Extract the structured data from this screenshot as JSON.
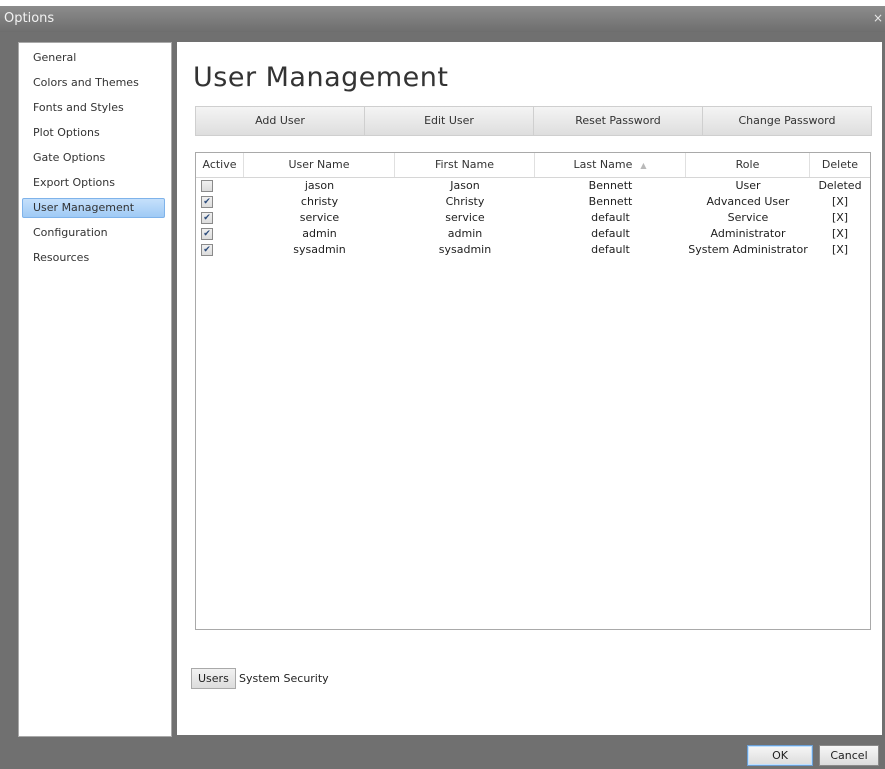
{
  "window": {
    "title": "Options",
    "close_glyph": "×"
  },
  "sidebar": {
    "items": [
      {
        "label": "General"
      },
      {
        "label": "Colors and Themes"
      },
      {
        "label": "Fonts and Styles"
      },
      {
        "label": "Plot Options"
      },
      {
        "label": "Gate Options"
      },
      {
        "label": "Export Options"
      },
      {
        "label": "User Management",
        "selected": true
      },
      {
        "label": "Configuration"
      },
      {
        "label": "Resources"
      }
    ]
  },
  "main": {
    "title": "User Management",
    "toolbar": {
      "add_user": "Add User",
      "edit_user": "Edit User",
      "reset_password": "Reset Password",
      "change_password": "Change Password"
    },
    "grid": {
      "columns": [
        "Active",
        "User Name",
        "First Name",
        "Last Name",
        "Role",
        "Delete"
      ],
      "sort_icon": "sort-ascending-icon",
      "rows": [
        {
          "active": false,
          "user_name": "jason",
          "first_name": "Jason",
          "last_name": "Bennett",
          "role": "User",
          "delete": "Deleted"
        },
        {
          "active": true,
          "user_name": "christy",
          "first_name": "Christy",
          "last_name": "Bennett",
          "role": "Advanced User",
          "delete": "[X]"
        },
        {
          "active": true,
          "user_name": "service",
          "first_name": "service",
          "last_name": "default",
          "role": "Service",
          "delete": "[X]"
        },
        {
          "active": true,
          "user_name": "admin",
          "first_name": "admin",
          "last_name": "default",
          "role": "Administrator",
          "delete": "[X]"
        },
        {
          "active": true,
          "user_name": "sysadmin",
          "first_name": "sysadmin",
          "last_name": "default",
          "role": "System Administrator",
          "delete": "[X]"
        }
      ]
    },
    "tabs": {
      "users": "Users",
      "system_security": "System Security"
    }
  },
  "footer": {
    "ok": "OK",
    "cancel": "Cancel"
  },
  "colors": {
    "selected_bg": "#9fcaf5",
    "chrome": "#707070",
    "ok_border": "#6a9fd6"
  }
}
